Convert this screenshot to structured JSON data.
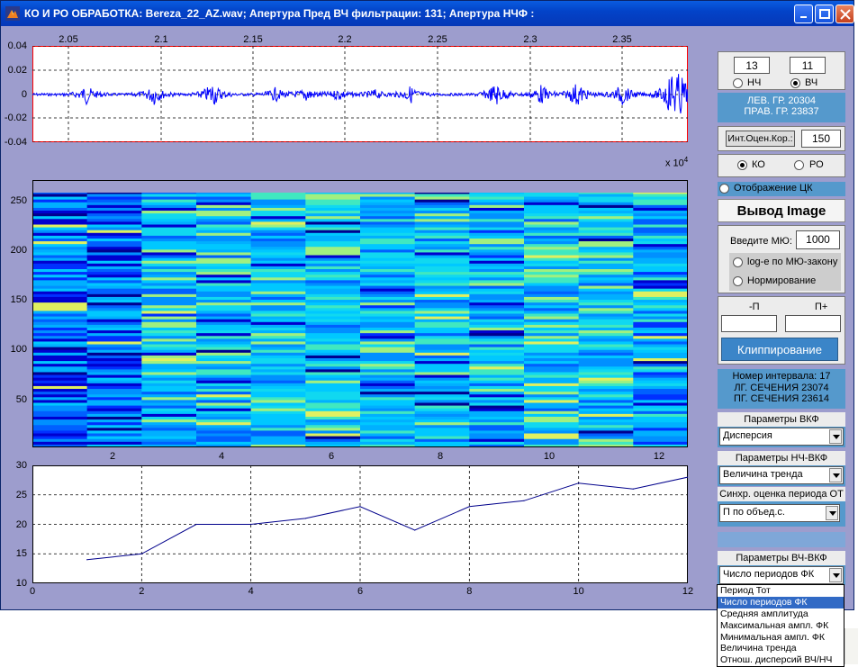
{
  "window": {
    "title": "КО И РО ОБРАБОТКА: Bereza_22_AZ.wav;  Апертура Пред ВЧ фильтрации: 131;  Апертура НЧФ :"
  },
  "top_plot": {
    "x_ticks": [
      "2.05",
      "2.1",
      "2.15",
      "2.2",
      "2.25",
      "2.3",
      "2.35"
    ],
    "y_ticks": [
      "0.04",
      "0.02",
      "0",
      "-0.02",
      "-0.04"
    ],
    "x_scale_label": "x 10",
    "x_scale_exp": "4",
    "line_color": "#0000ff",
    "border_color": "#ff0000"
  },
  "mid_plot": {
    "y_ticks": [
      "250",
      "200",
      "150",
      "100",
      "50"
    ],
    "x_ticks": [
      "2",
      "4",
      "6",
      "8",
      "10",
      "12"
    ]
  },
  "chart_data": {
    "type": "line",
    "x": [
      1,
      2,
      3,
      4,
      5,
      6,
      7,
      8,
      9,
      10,
      11,
      12
    ],
    "series": [
      {
        "values": [
          14,
          15,
          20,
          20,
          21,
          23,
          19,
          23,
          24,
          27,
          26,
          28
        ]
      }
    ],
    "xlim": [
      0,
      12
    ],
    "ylim": [
      10,
      30
    ],
    "x_ticks": [
      "0",
      "2",
      "4",
      "6",
      "8",
      "10",
      "12"
    ],
    "y_ticks": [
      "30",
      "25",
      "20",
      "15",
      "10"
    ],
    "grid": true,
    "line_color": "#00008b"
  },
  "controls": {
    "field_left": "13",
    "field_right": "11",
    "radio_lf": "НЧ",
    "radio_hf": "ВЧ",
    "left_bound": "ЛЕВ. ГР.  20304",
    "right_bound": "ПРАВ. ГР. 23837",
    "int_corr_label": "Инт.Оцен.Кор.:",
    "int_corr_value": "150",
    "radio_ko": "КО",
    "radio_ro": "РО",
    "show_tsk": "Отображение ЦК",
    "output_image": "Вывод Image",
    "mu_label": "Введите МЮ:",
    "mu_value": "1000",
    "log_mu": "log-е по МЮ-закону",
    "normalize": "Нормирование",
    "p_minus": "-П",
    "p_plus": "П+",
    "clip_button": "Клиппирование",
    "interval_no": "Номер интервала: 17",
    "lg_section": "ЛГ. СЕЧЕНИЯ 23074",
    "pg_section": "ПГ. СЕЧЕНИЯ 23614",
    "vkf_params": "Параметры ВКФ",
    "vkf_select": "Дисперсия",
    "lf_vkf_params": "Параметры НЧ-ВКФ",
    "lf_vkf_select": "Величина тренда",
    "sync_label": "Синхр. оценка периода ОТ",
    "sync_select": "П по объед.с.",
    "hf_vkf_params": "Параметры ВЧ-ВКФ",
    "hf_vkf_select": "Число периодов ФК"
  },
  "dropdown_options": [
    "Период Тот",
    "Число периодов ФК",
    "Средняя амплитуда",
    "Максимальная ампл. ФК",
    "Минимальная ампл. ФК",
    "Величина тренда",
    "Отнош. дисперсий ВЧ/НЧ"
  ],
  "dropdown_selected_index": 1,
  "colors": {
    "window_bg": "#9d9dcd",
    "title_bar": "#0343c8",
    "info_panel": "#5599cc"
  }
}
